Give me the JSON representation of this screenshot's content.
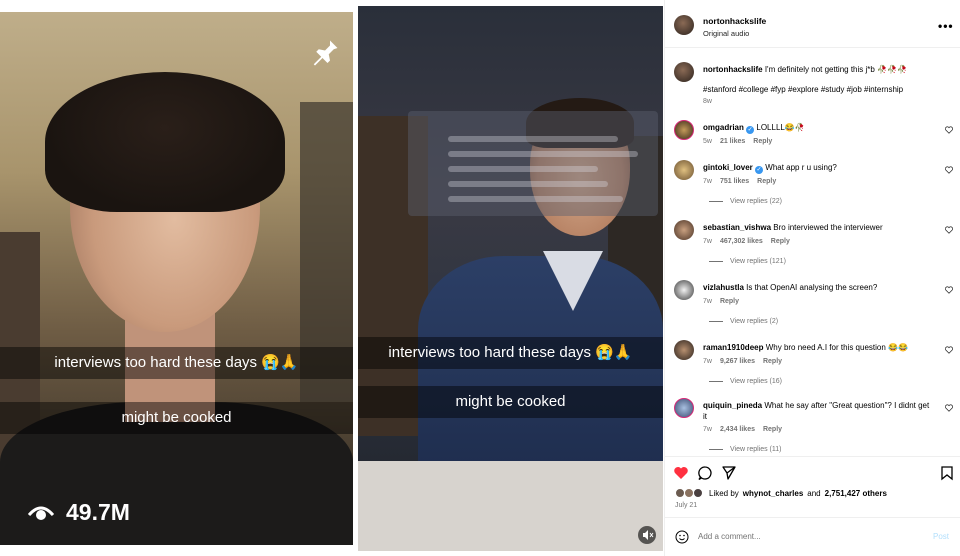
{
  "left_video": {
    "caption_1": "interviews too hard these days 😭🙏",
    "caption_2": "might be cooked",
    "views": "49.7M",
    "icons": [
      "pin-icon",
      "eye-icon"
    ]
  },
  "middle_video": {
    "caption_1": "interviews too hard these days 😭🙏",
    "caption_2": "might be cooked",
    "icons": [
      "mute-icon"
    ]
  },
  "post": {
    "username": "nortonhackslife",
    "audio": "Original audio",
    "caption_user": "nortonhackslife",
    "caption_text": "I'm definitely not getting this j*b 🥀🥀🥀",
    "hashtags": "#stanford #college #fyp #explore #study #job #internship",
    "age": "8w"
  },
  "comments": [
    {
      "user": "omgadrian",
      "verified": true,
      "text": "LOLLLL😂🥀",
      "age": "5w",
      "likes": "21 likes",
      "reply": "Reply",
      "view_replies": ""
    },
    {
      "user": "gintoki_lover",
      "verified": true,
      "text": "What app r u using?",
      "age": "7w",
      "likes": "751 likes",
      "reply": "Reply",
      "view_replies": "View replies (22)"
    },
    {
      "user": "sebastian_vishwa",
      "verified": false,
      "text": "Bro interviewed the interviewer",
      "age": "7w",
      "likes": "467,302 likes",
      "reply": "Reply",
      "view_replies": "View replies (121)"
    },
    {
      "user": "vizlahustla",
      "verified": false,
      "text": "Is that OpenAI analysing the screen?",
      "age": "7w",
      "likes": "",
      "reply": "Reply",
      "view_replies": "View replies (2)"
    },
    {
      "user": "raman1910deep",
      "verified": false,
      "text": "Why bro need A.I for this question 😂😂",
      "age": "7w",
      "likes": "9,267 likes",
      "reply": "Reply",
      "view_replies": "View replies (16)"
    },
    {
      "user": "quiquin_pineda",
      "verified": false,
      "text": "What he say after \"Great question\"? I didnt get it",
      "age": "7w",
      "likes": "2,434 likes",
      "reply": "Reply",
      "view_replies": "View replies (11)"
    }
  ],
  "footer": {
    "liked_by_prefix": "Liked by",
    "liked_by_user": "whynot_charles",
    "liked_by_and": "and",
    "liked_by_count": "2,751,427 others",
    "date": "July 21",
    "add_comment_placeholder": "Add a comment...",
    "post_label": "Post"
  },
  "colors": {
    "like_red": "#ff3040",
    "verified_blue": "#3897f0",
    "hashtag_blue": "#00376b",
    "muted_text": "#737373",
    "post_disabled": "#b2dffc"
  }
}
